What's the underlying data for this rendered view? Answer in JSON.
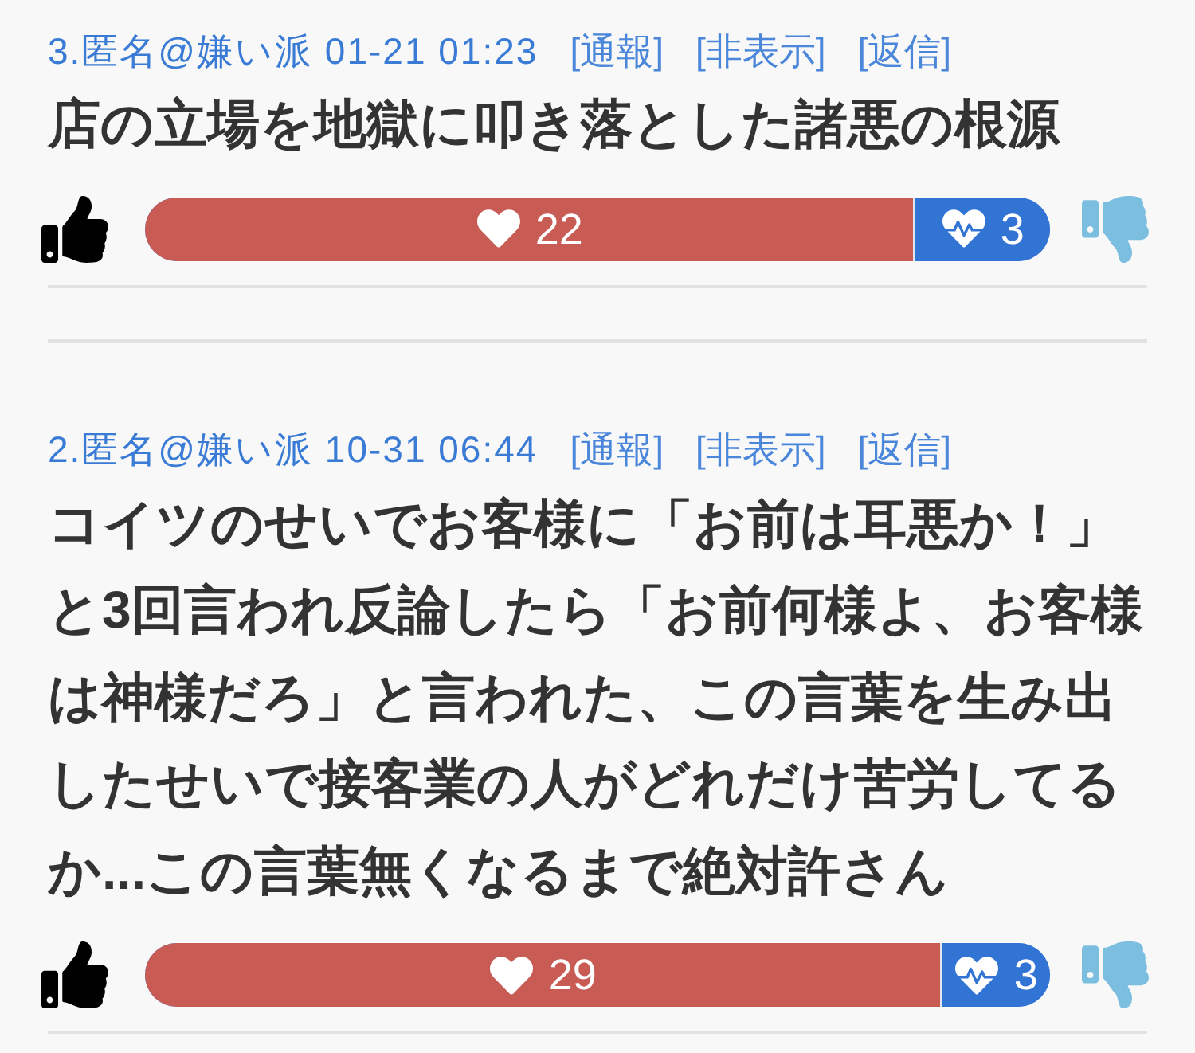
{
  "comments": [
    {
      "meta": "3.匿名@嫌い派 01-21 01:23",
      "actions": [
        "[通報]",
        "[非表示]",
        "[返信]"
      ],
      "body": "店の立場を地獄に叩き落とした諸悪の根源",
      "votes": {
        "level": 0.85,
        "good_count": "22",
        "bad_count": "3"
      }
    },
    {
      "meta": "2.匿名@嫌い派 10-31 06:44",
      "actions": [
        "[通報]",
        "[非表示]",
        "[返信]"
      ],
      "body": "コイツのせいでお客様に「お前は耳悪か！」と3回言われ反論したら「お前何様よ、お客様は神様だろ」と言われた、この言葉を生み出したせいで接客業の人がどれだけ苦労してるか...この言葉無くなるまで絶対許さん",
      "votes": {
        "level": 0.88,
        "good_count": "29",
        "bad_count": "3"
      }
    }
  ]
}
